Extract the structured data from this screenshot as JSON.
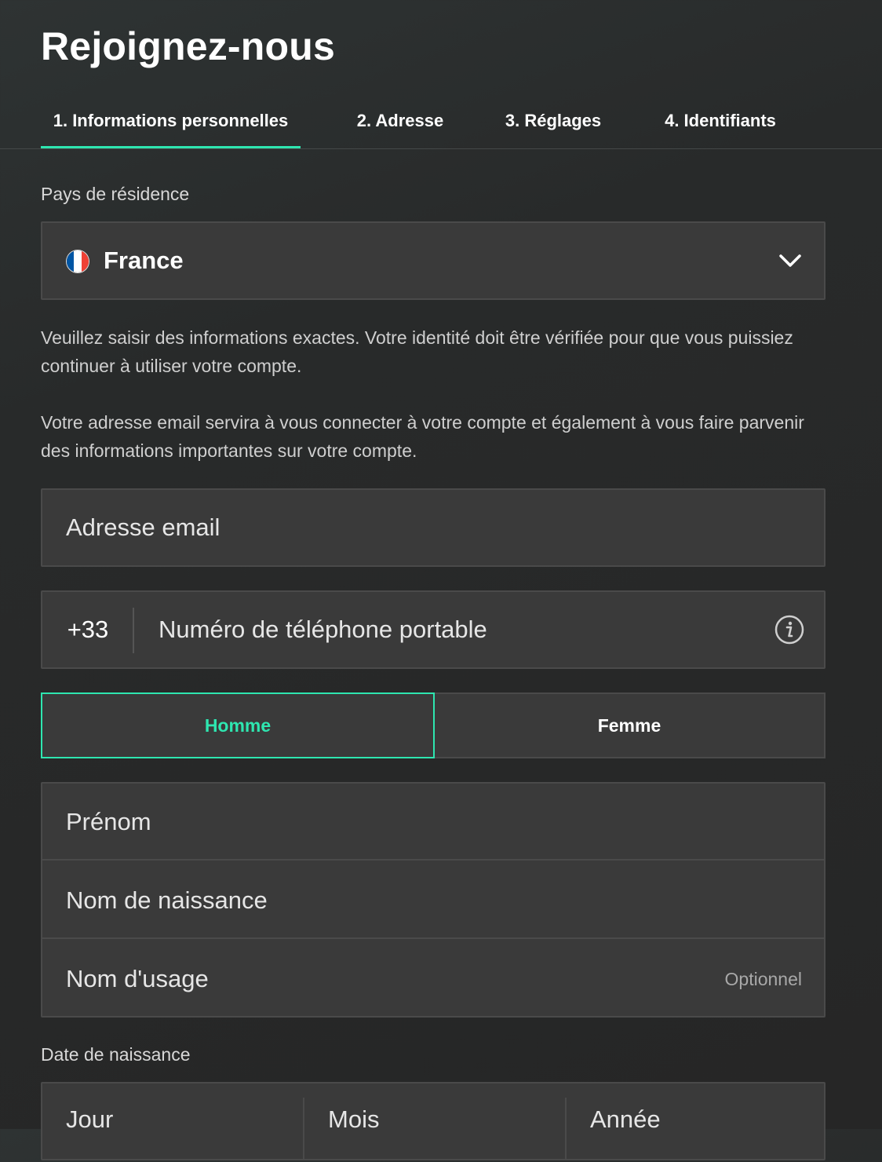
{
  "page": {
    "title": "Rejoignez-nous"
  },
  "tabs": [
    {
      "label": "1.  Informations personnelles",
      "active": true
    },
    {
      "label": "2.  Adresse",
      "active": false
    },
    {
      "label": "3.  Réglages",
      "active": false
    },
    {
      "label": "4.  Identifiants",
      "active": false
    }
  ],
  "country": {
    "label": "Pays de résidence",
    "value": "France",
    "flag_colors": [
      "#0055A4",
      "#FFFFFF",
      "#EF4135"
    ]
  },
  "info_text": {
    "p1": "Veuillez saisir des informations exactes. Votre identité doit être vérifiée pour que vous puissiez continuer à utiliser votre compte.",
    "p2": "Votre adresse email servira à vous connecter à votre compte et également à vous faire parvenir des informations importantes sur votre compte."
  },
  "email": {
    "placeholder": "Adresse email"
  },
  "phone": {
    "prefix": "+33",
    "placeholder": "Numéro de téléphone portable"
  },
  "gender": {
    "male": "Homme",
    "female": "Femme",
    "selected": "Homme"
  },
  "names": {
    "first": "Prénom",
    "birth": "Nom de naissance",
    "usage": "Nom d'usage",
    "optional": "Optionnel"
  },
  "dob": {
    "label": "Date de naissance",
    "day": "Jour",
    "month": "Mois",
    "year": "Année"
  },
  "colors": {
    "accent": "#2ee6b0",
    "field_bg": "#3a3a3a",
    "page_bg": "#282828"
  }
}
